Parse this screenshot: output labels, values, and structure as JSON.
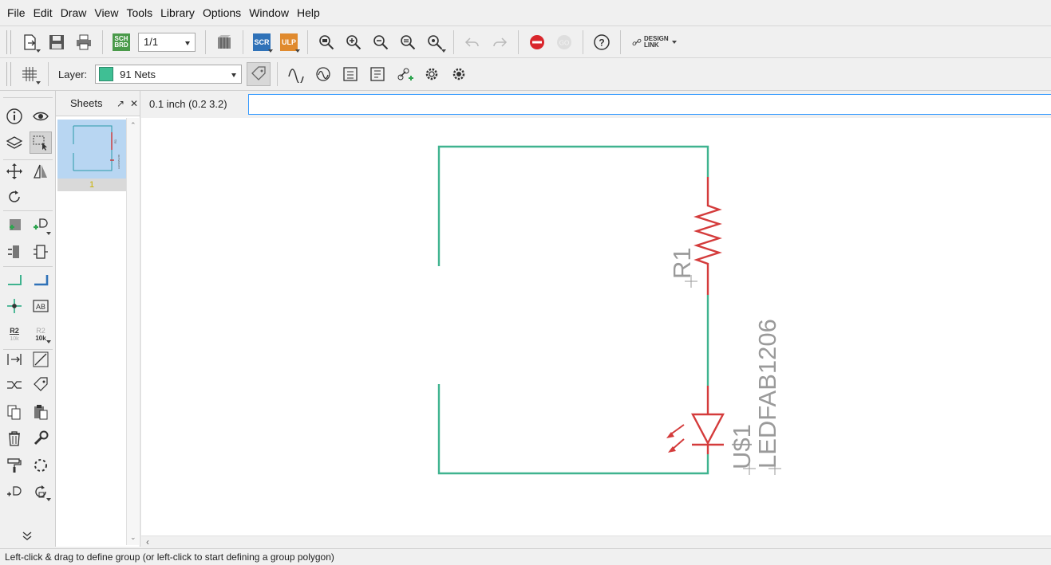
{
  "menu": [
    "File",
    "Edit",
    "Draw",
    "View",
    "Tools",
    "Library",
    "Options",
    "Window",
    "Help"
  ],
  "toolbar": {
    "sheet_combo": "1/1",
    "sch_brd_label": "SCH BRD",
    "scr_label": "SCR",
    "ulp_label": "ULP",
    "go_label": "GO",
    "help_label": "?",
    "design_link_label": "DESIGN\nLINK"
  },
  "toolbar2": {
    "layer_label": "Layer:",
    "layer_value": "91 Nets",
    "layer_color": "#3fbf94"
  },
  "sheets": {
    "title": "Sheets",
    "thumb_number": "1"
  },
  "commandline": {
    "coords": "0.1 inch (0.2 3.2)",
    "value": ""
  },
  "schematic": {
    "resistor_name": "R1",
    "led_name": "U$1",
    "led_value": "LEDFAB1206",
    "net_color": "#3fb38f",
    "part_color": "#d43b3b",
    "label_color": "#9a9a9a"
  },
  "status": {
    "text": "Left-click & drag to define group (or left-click to start defining a group polygon)"
  },
  "icons": [
    "new-icon",
    "save-icon",
    "print-icon",
    "zoom-fit-icon",
    "zoom-in-icon",
    "zoom-out-icon",
    "undo-icon",
    "redo-icon",
    "stop-icon",
    "grid-icon",
    "info-icon",
    "eye-icon",
    "move-icon",
    "rotate-icon",
    "wire-icon",
    "junction-icon",
    "delete-icon",
    "wrench-icon"
  ]
}
